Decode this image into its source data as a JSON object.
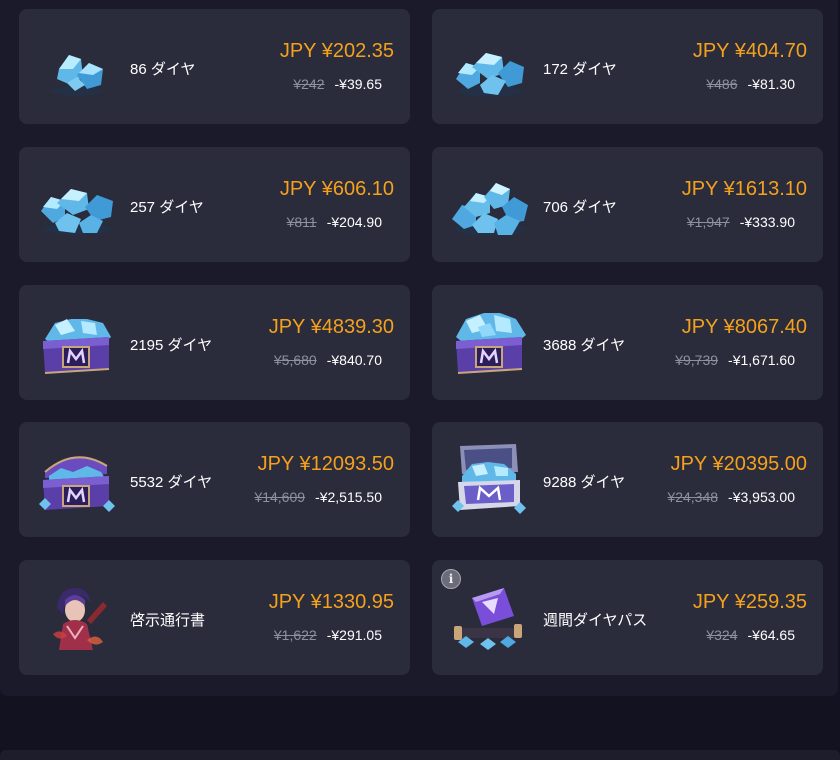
{
  "products": [
    {
      "name": "86 ダイヤ",
      "price": "JPY ¥202.35",
      "original": "¥242",
      "discount": "-¥39.65",
      "icon": "diamond-small-pile-icon"
    },
    {
      "name": "172 ダイヤ",
      "price": "JPY ¥404.70",
      "original": "¥486",
      "discount": "-¥81.30",
      "icon": "diamond-pile-icon"
    },
    {
      "name": "257 ダイヤ",
      "price": "JPY ¥606.10",
      "original": "¥811",
      "discount": "-¥204.90",
      "icon": "diamond-pile-icon"
    },
    {
      "name": "706 ダイヤ",
      "price": "JPY ¥1613.10",
      "original": "¥1,947",
      "discount": "-¥333.90",
      "icon": "diamond-large-pile-icon"
    },
    {
      "name": "2195 ダイヤ",
      "price": "JPY ¥4839.30",
      "original": "¥5,680",
      "discount": "-¥840.70",
      "icon": "diamond-box-icon"
    },
    {
      "name": "3688 ダイヤ",
      "price": "JPY ¥8067.40",
      "original": "¥9,739",
      "discount": "-¥1,671.60",
      "icon": "diamond-box-icon"
    },
    {
      "name": "5532 ダイヤ",
      "price": "JPY ¥12093.50",
      "original": "¥14,609",
      "discount": "-¥2,515.50",
      "icon": "diamond-chest-icon"
    },
    {
      "name": "9288 ダイヤ",
      "price": "JPY ¥20395.00",
      "original": "¥24,348",
      "discount": "-¥3,953.00",
      "icon": "diamond-open-chest-icon"
    },
    {
      "name": "啓示通行書",
      "price": "JPY ¥1330.95",
      "original": "¥1,622",
      "discount": "-¥291.05",
      "icon": "hero-portrait-icon"
    },
    {
      "name": "週間ダイヤパス",
      "price": "JPY ¥259.35",
      "original": "¥324",
      "discount": "-¥64.65",
      "icon": "weekly-pass-icon",
      "info_badge": "i"
    }
  ]
}
